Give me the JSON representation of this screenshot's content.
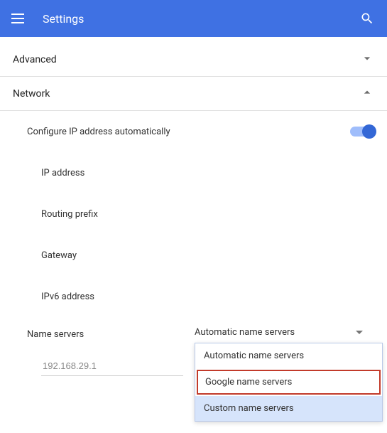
{
  "header": {
    "title": "Settings"
  },
  "sections": {
    "advanced": {
      "label": "Advanced"
    },
    "network": {
      "label": "Network"
    }
  },
  "network": {
    "auto_ip_label": "Configure IP address automatically",
    "auto_ip_enabled": true,
    "fields": {
      "ip_address": "IP address",
      "routing_prefix": "Routing prefix",
      "gateway": "Gateway",
      "ipv6_address": "IPv6 address"
    },
    "name_servers": {
      "label": "Name servers",
      "selected": "Automatic name servers",
      "options": [
        "Automatic name servers",
        "Google name servers",
        "Custom name servers"
      ],
      "input_value": "192.168.29.1"
    }
  },
  "colors": {
    "header_bg": "#3f71e3",
    "toggle_on": "#3367d6",
    "highlight_border": "#c23a2a",
    "option_selected_bg": "#d6e4fb"
  }
}
